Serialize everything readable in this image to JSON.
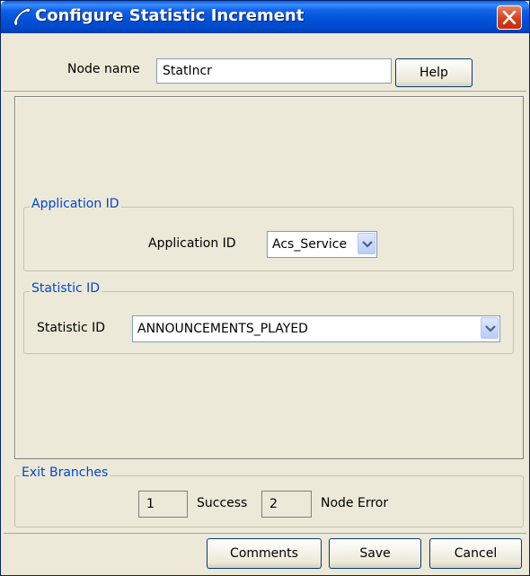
{
  "window": {
    "title": "Configure Statistic Increment",
    "icons": {
      "app": "telephone-handset-icon",
      "close": "close-icon"
    }
  },
  "node": {
    "label": "Node name",
    "value": "StatIncr",
    "help_label": "Help"
  },
  "application_group": {
    "title": "Application ID",
    "field_label": "Application ID",
    "selected": "Acs_Service"
  },
  "statistic_group": {
    "title": "Statistic ID",
    "field_label": "Statistic ID",
    "selected": "ANNOUNCEMENTS_PLAYED"
  },
  "exit_branches": {
    "title": "Exit Branches",
    "branches": [
      {
        "number": "1",
        "label": "Success"
      },
      {
        "number": "2",
        "label": "Node Error"
      }
    ]
  },
  "footer": {
    "comments_label": "Comments",
    "save_label": "Save",
    "cancel_label": "Cancel"
  },
  "colors": {
    "title_bar": "#0054e3",
    "dialog_bg": "#ece9d8",
    "group_title": "#0046d5",
    "close_button": "#d6401c"
  }
}
